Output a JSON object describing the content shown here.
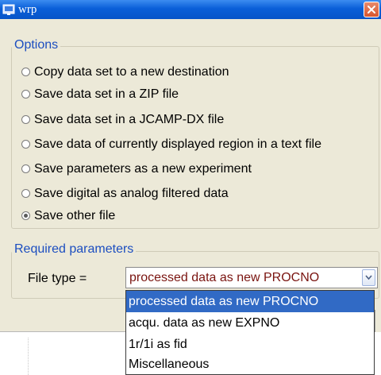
{
  "window": {
    "title": "wrp"
  },
  "options": {
    "legend": "Options",
    "items": [
      {
        "label": "Copy data set to a new destination",
        "checked": false
      },
      {
        "label": "Save data set in a ZIP file",
        "checked": false
      },
      {
        "label": "Save data set in a JCAMP-DX file",
        "checked": false
      },
      {
        "label": "Save data of currently displayed region in a text file",
        "checked": false
      },
      {
        "label": "Save parameters as a new experiment",
        "checked": false
      },
      {
        "label": "Save digital as analog filtered data",
        "checked": false
      },
      {
        "label": "Save other file",
        "checked": true
      }
    ]
  },
  "parameters": {
    "legend": "Required parameters",
    "file_type_label": "File type =",
    "file_type_value": "processed data as new PROCNO",
    "file_type_options": [
      {
        "label": "processed data as new PROCNO",
        "selected": true
      },
      {
        "label": "acqu. data as new EXPNO",
        "selected": false
      },
      {
        "label": "1r/1i as fid",
        "selected": false
      },
      {
        "label": "Miscellaneous",
        "selected": false
      }
    ]
  },
  "colors": {
    "titlebar": "#0a5fd8",
    "legend_text": "#1c4ec0",
    "selection": "#316ac5",
    "combo_text": "#7a1410",
    "close_button": "#d8562e"
  }
}
